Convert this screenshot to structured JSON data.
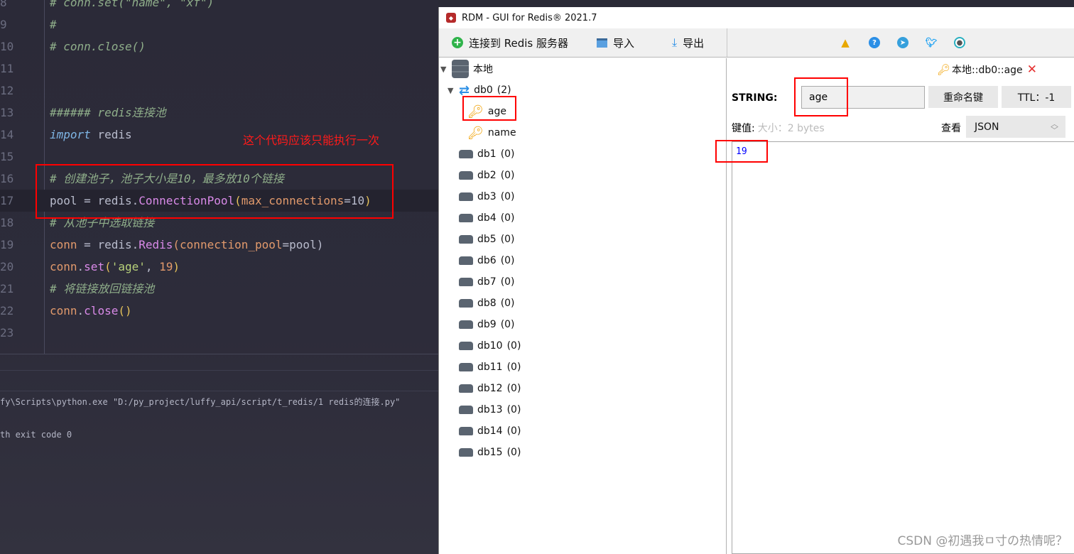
{
  "ide": {
    "lines": [
      {
        "n": "8",
        "tokens": [
          {
            "t": "# conn.set(\"name\", \"xf\")",
            "k": "com"
          }
        ]
      },
      {
        "n": "9",
        "tokens": [
          {
            "t": "#",
            "k": "com"
          }
        ]
      },
      {
        "n": "10",
        "tokens": [
          {
            "t": "# conn.close()",
            "k": "com"
          }
        ]
      },
      {
        "n": "11",
        "tokens": []
      },
      {
        "n": "12",
        "tokens": []
      },
      {
        "n": "13",
        "tokens": [
          {
            "t": "###### redis连接池",
            "k": "com"
          }
        ]
      },
      {
        "n": "14",
        "tokens": [
          {
            "t": "import",
            "k": "kw"
          },
          {
            "t": " redis",
            "k": "id"
          }
        ]
      },
      {
        "n": "15",
        "tokens": []
      },
      {
        "n": "16",
        "tokens": [
          {
            "t": "# 创建池子，池子大小是10，最多放10个链接",
            "k": "com"
          }
        ]
      },
      {
        "n": "17",
        "tokens": [
          {
            "t": "pool",
            "k": "id"
          },
          {
            "t": " = ",
            "k": "op"
          },
          {
            "t": "redis.",
            "k": "id"
          },
          {
            "t": "ConnectionPool",
            "k": "cls"
          },
          {
            "t": "(",
            "k": "par"
          },
          {
            "t": "max_connections",
            "k": "arg"
          },
          {
            "t": "=10",
            "k": "id"
          },
          {
            "t": ")",
            "k": "par"
          }
        ],
        "current": true
      },
      {
        "n": "18",
        "tokens": [
          {
            "t": "# 从池子中选取链接",
            "k": "com"
          }
        ]
      },
      {
        "n": "19",
        "tokens": [
          {
            "t": "conn",
            "k": "var"
          },
          {
            "t": " = ",
            "k": "op"
          },
          {
            "t": "redis.",
            "k": "id"
          },
          {
            "t": "Redis",
            "k": "cls"
          },
          {
            "t": "(connection_pool",
            "k": "arg"
          },
          {
            "t": "=pool)",
            "k": "id"
          }
        ]
      },
      {
        "n": "20",
        "tokens": [
          {
            "t": "conn",
            "k": "var"
          },
          {
            "t": ".",
            "k": "op"
          },
          {
            "t": "set",
            "k": "cls"
          },
          {
            "t": "(",
            "k": "par"
          },
          {
            "t": "'age'",
            "k": "str"
          },
          {
            "t": ", ",
            "k": "op"
          },
          {
            "t": "19",
            "k": "num"
          },
          {
            "t": ")",
            "k": "par"
          }
        ]
      },
      {
        "n": "21",
        "tokens": [
          {
            "t": "# 将链接放回链接池",
            "k": "com"
          }
        ]
      },
      {
        "n": "22",
        "tokens": [
          {
            "t": "conn",
            "k": "var"
          },
          {
            "t": ".",
            "k": "op"
          },
          {
            "t": "close",
            "k": "cls"
          },
          {
            "t": "()",
            "k": "par"
          }
        ]
      },
      {
        "n": "23",
        "tokens": []
      }
    ],
    "annotation": "这个代码应该只能执行一次",
    "terminal": {
      "command": "fy\\Scripts\\python.exe \"D:/py_project/luffy_api/script/t_redis/1 redis的连接.py\"",
      "exit": "th exit code 0"
    }
  },
  "rdm": {
    "title": "RDM - GUI for Redis® 2021.7",
    "toolbar": {
      "connect": "连接到 Redis 服务器",
      "import": "导入",
      "export": "导出"
    },
    "tree": {
      "server": "本地",
      "databases": [
        {
          "name": "db0",
          "count": "(2)",
          "expanded": true,
          "keys": [
            "age",
            "name"
          ]
        },
        {
          "name": "db1",
          "count": "(0)"
        },
        {
          "name": "db2",
          "count": "(0)"
        },
        {
          "name": "db3",
          "count": "(0)"
        },
        {
          "name": "db4",
          "count": "(0)"
        },
        {
          "name": "db5",
          "count": "(0)"
        },
        {
          "name": "db6",
          "count": "(0)"
        },
        {
          "name": "db7",
          "count": "(0)"
        },
        {
          "name": "db8",
          "count": "(0)"
        },
        {
          "name": "db9",
          "count": "(0)"
        },
        {
          "name": "db10",
          "count": "(0)"
        },
        {
          "name": "db11",
          "count": "(0)"
        },
        {
          "name": "db12",
          "count": "(0)"
        },
        {
          "name": "db13",
          "count": "(0)"
        },
        {
          "name": "db14",
          "count": "(0)"
        },
        {
          "name": "db15",
          "count": "(0)"
        }
      ]
    },
    "detail": {
      "tab": "本地::db0::age",
      "type_label": "STRING:",
      "key_name": "age",
      "rename": "重命名键",
      "ttl": "TTL：-1",
      "value_label": "键值:",
      "size": "大小：2 bytes",
      "view_label": "查看",
      "view_mode": "JSON",
      "value": "19"
    }
  },
  "watermark": "CSDN @初遇我ㅁ寸の热情呢？"
}
